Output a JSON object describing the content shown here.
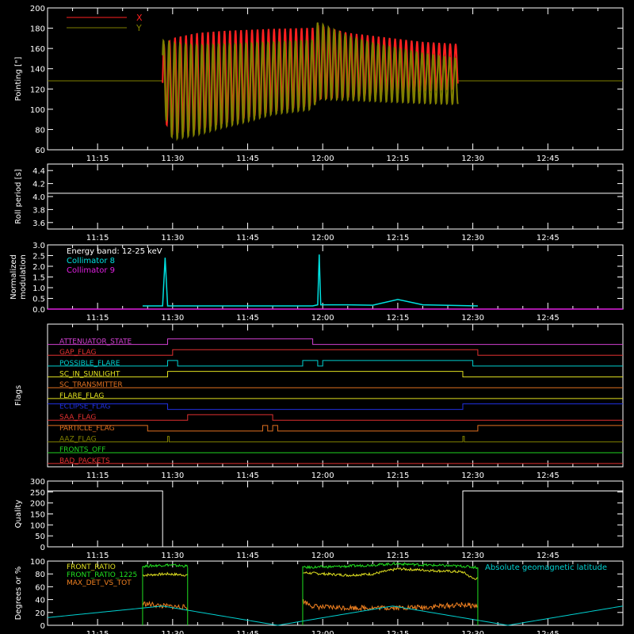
{
  "panel_ylabels": {
    "pointing": "Pointing [\"]",
    "roll": "Roll period [s]",
    "modulation_1": "Normalized",
    "modulation_2": "modulation",
    "flags": "Flags",
    "quality": "Quality",
    "geo": "Degrees or %"
  },
  "time_ticks": [
    "11:15",
    "11:30",
    "11:45",
    "12:00",
    "12:15",
    "12:30",
    "12:45"
  ],
  "colors": {
    "axis": "#ffffff",
    "x": "#ff2020",
    "y": "#808000",
    "coll8": "#00e0e0",
    "coll9": "#e020e0",
    "geo": "#00d0d0"
  },
  "chart_data": [
    {
      "type": "line",
      "title": "",
      "ylabel": "Pointing [\"]",
      "ylim": [
        60,
        200
      ],
      "yticks": [
        60,
        80,
        100,
        120,
        140,
        160,
        180,
        200
      ],
      "x_range": [
        "11:05",
        "13:00"
      ],
      "series": [
        {
          "name": "X",
          "color": "#ff2020",
          "envelope_times": [
            "11:28",
            "11:30",
            "11:35",
            "11:40",
            "11:45",
            "11:50",
            "11:58",
            "11:59",
            "12:05",
            "12:10",
            "12:15",
            "12:20",
            "12:27"
          ],
          "upper": [
            162,
            170,
            175,
            177,
            178,
            179,
            180,
            183,
            175,
            172,
            169,
            166,
            164
          ],
          "lower": [
            90,
            76,
            80,
            86,
            92,
            98,
            104,
            110,
            112,
            114,
            116,
            118,
            120
          ]
        },
        {
          "name": "Y",
          "color": "#808000",
          "envelope_times": [
            "11:28",
            "11:30",
            "11:35",
            "11:40",
            "11:45",
            "11:50",
            "11:58",
            "11:59",
            "12:05",
            "12:10",
            "12:15",
            "12:20",
            "12:27"
          ],
          "upper": [
            168,
            165,
            163,
            164,
            165,
            166,
            168,
            186,
            172,
            165,
            160,
            155,
            150
          ],
          "lower": [
            100,
            70,
            75,
            82,
            88,
            95,
            100,
            110,
            109,
            108,
            107,
            106,
            105
          ],
          "idle_value": 128
        }
      ],
      "legend": "top-left"
    },
    {
      "type": "line",
      "ylabel": "Roll period [s]",
      "ylim": [
        3.5,
        4.5
      ],
      "yticks": [
        3.6,
        3.8,
        4.0,
        4.2,
        4.4
      ],
      "series": [
        {
          "name": "",
          "color": "#ffffff",
          "x": [
            "11:05",
            "13:00"
          ],
          "values": [
            4.05,
            4.05
          ]
        }
      ]
    },
    {
      "type": "line",
      "ylabel": "Normalized modulation",
      "ylim": [
        0,
        3.0
      ],
      "yticks": [
        0.0,
        0.5,
        1.0,
        1.5,
        2.0,
        2.5,
        3.0
      ],
      "annotation": "Energy band: 12-25 keV",
      "series": [
        {
          "name": "Collimator 8",
          "color": "#00e0e0",
          "x": [
            "11:24",
            "11:27",
            "11:28",
            "11:28.5",
            "11:29",
            "11:32",
            "11:58",
            "11:59",
            "11:59.3",
            "11:59.6",
            "12:05",
            "12:10",
            "12:15",
            "12:20",
            "12:31"
          ],
          "values": [
            0.15,
            0.15,
            0.15,
            2.4,
            0.15,
            0.15,
            0.15,
            0.2,
            2.55,
            0.2,
            0.2,
            0.18,
            0.45,
            0.2,
            0.15
          ]
        },
        {
          "name": "Collimator 9",
          "color": "#e020e0",
          "x": [
            "11:05",
            "13:00"
          ],
          "values": [
            0.0,
            0.0
          ]
        }
      ],
      "legend": "top-left"
    },
    {
      "type": "table",
      "ylabel": "Flags",
      "rows": [
        {
          "name": "ATTENUATOR_STATE",
          "color": "#d040d0",
          "segments": [
            [
              "11:05",
              "11:29",
              0
            ],
            [
              "11:29",
              "11:58",
              1
            ],
            [
              "11:58",
              "13:00",
              0
            ]
          ]
        },
        {
          "name": "GAP_FLAG",
          "color": "#e03030",
          "segments": [
            [
              "11:05",
              "11:30",
              0
            ],
            [
              "11:30",
              "12:31",
              1
            ],
            [
              "12:31",
              "13:00",
              0
            ]
          ]
        },
        {
          "name": "POSSIBLE_FLARE",
          "color": "#00d0d0",
          "segments": [
            [
              "11:05",
              "11:29",
              0
            ],
            [
              "11:29",
              "11:31",
              1
            ],
            [
              "11:31",
              "11:56",
              0
            ],
            [
              "11:56",
              "11:59",
              1
            ],
            [
              "11:59",
              "12:00",
              0
            ],
            [
              "12:00",
              "12:30",
              1
            ],
            [
              "12:30",
              "13:00",
              0
            ]
          ]
        },
        {
          "name": "SC_IN_SUNLIGHT",
          "color": "#e0e020",
          "segments": [
            [
              "11:05",
              "11:29",
              0
            ],
            [
              "11:29",
              "12:28",
              1
            ],
            [
              "12:28",
              "13:00",
              0
            ]
          ]
        },
        {
          "name": "SC_TRANSMITTER",
          "color": "#e07020",
          "segments": [
            [
              "11:05",
              "13:00",
              0
            ]
          ]
        },
        {
          "name": "FLARE_FLAG",
          "color": "#e0e020",
          "segments": [
            [
              "11:05",
              "13:00",
              0
            ]
          ]
        },
        {
          "name": "ECLIPSE_FLAG",
          "color": "#2030e0",
          "segments": [
            [
              "11:05",
              "11:29",
              1
            ],
            [
              "11:29",
              "12:28",
              0
            ],
            [
              "12:28",
              "13:00",
              1
            ]
          ]
        },
        {
          "name": "SAA_FLAG",
          "color": "#e03030",
          "segments": [
            [
              "11:05",
              "11:33",
              0
            ],
            [
              "11:33",
              "11:50",
              1
            ],
            [
              "11:50",
              "13:00",
              0
            ]
          ]
        },
        {
          "name": "PARTICLE_FLAG",
          "color": "#e07020",
          "segments": [
            [
              "11:05",
              "11:25",
              1
            ],
            [
              "11:25",
              "11:48",
              0
            ],
            [
              "11:48",
              "11:49",
              1
            ],
            [
              "11:49",
              "11:50",
              0
            ],
            [
              "11:50",
              "11:51",
              1
            ],
            [
              "11:51",
              "12:31",
              0
            ],
            [
              "12:31",
              "13:00",
              1
            ]
          ]
        },
        {
          "name": "AAZ_FLAG",
          "color": "#808000",
          "segments": [
            [
              "11:05",
              "11:29",
              0
            ],
            [
              "11:29",
              "11:29.3",
              1
            ],
            [
              "11:29.3",
              "12:28",
              0
            ],
            [
              "12:28",
              "12:28.3",
              1
            ],
            [
              "12:28.3",
              "13:00",
              0
            ]
          ]
        },
        {
          "name": "FRONTS_OFF",
          "color": "#20d020",
          "segments": [
            [
              "11:05",
              "13:00",
              0
            ]
          ]
        },
        {
          "name": "BAD_PACKETS",
          "color": "#e03030",
          "segments": [
            [
              "11:05",
              "13:00",
              0
            ]
          ]
        }
      ]
    },
    {
      "type": "line",
      "ylabel": "Quality",
      "ylim": [
        0,
        300
      ],
      "yticks": [
        0,
        50,
        100,
        150,
        200,
        250,
        300
      ],
      "series": [
        {
          "name": "",
          "color": "#ffffff",
          "x": [
            "11:05",
            "11:28",
            "11:28",
            "12:28",
            "12:28",
            "13:00"
          ],
          "values": [
            255,
            255,
            0,
            0,
            255,
            255
          ]
        }
      ]
    },
    {
      "type": "line",
      "ylabel": "Degrees or %",
      "ylim": [
        0,
        100
      ],
      "yticks": [
        0,
        20,
        40,
        60,
        80,
        100
      ],
      "series": [
        {
          "name": "FRONT_RATIO",
          "color": "#e0e020",
          "x": [
            "11:24",
            "11:29",
            "11:33",
            "11:56",
            "12:05",
            "12:10",
            "12:15",
            "12:20",
            "12:28",
            "12:30",
            "12:31"
          ],
          "values": [
            78,
            80,
            78,
            82,
            78,
            80,
            88,
            86,
            83,
            73,
            73
          ]
        },
        {
          "name": "FRONT_RATIO_1225",
          "color": "#20e020",
          "x": [
            "11:24",
            "11:29",
            "11:33",
            "11:56",
            "12:05",
            "12:10",
            "12:15",
            "12:20",
            "12:28",
            "12:31"
          ],
          "values": [
            92,
            94,
            92,
            90,
            92,
            94,
            96,
            94,
            92,
            90
          ]
        },
        {
          "name": "MAX_DET_VS_TOT",
          "color": "#f08020",
          "x": [
            "11:24",
            "11:26",
            "11:28",
            "11:33",
            "11:56",
            "11:58",
            "12:00",
            "12:10",
            "12:20",
            "12:28",
            "12:31"
          ],
          "values": [
            34,
            32,
            30,
            28,
            38,
            30,
            28,
            27,
            28,
            32,
            30
          ]
        },
        {
          "name": "Absolute geomagnetic latitude",
          "color": "#00d0d0",
          "x": [
            "11:05",
            "11:28",
            "11:51",
            "12:14",
            "12:37",
            "13:00"
          ],
          "values": [
            12,
            30,
            0,
            30,
            0,
            30
          ]
        }
      ],
      "legend": "top-left"
    }
  ]
}
